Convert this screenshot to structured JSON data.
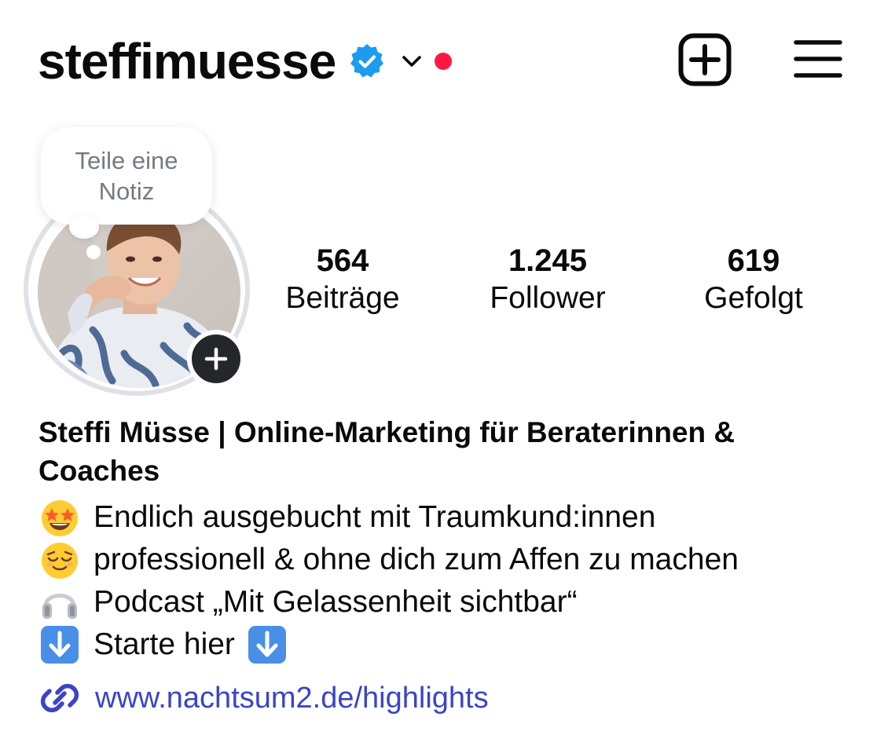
{
  "header": {
    "username": "steffimuesse",
    "verified_icon": "verified-badge-icon",
    "dropdown_icon": "chevron-down-icon",
    "notification_dot_color": "#ff1744",
    "new_post_icon": "plus-square-icon",
    "menu_icon": "hamburger-menu-icon"
  },
  "profile": {
    "note_text": "Teile eine Notiz",
    "add_story_icon": "plus-icon",
    "stats": [
      {
        "value": "564",
        "label": "Beiträge"
      },
      {
        "value": "1.245",
        "label": "Follower"
      },
      {
        "value": "619",
        "label": "Gefolgt"
      }
    ]
  },
  "bio": {
    "name": "Steffi Müsse | Online-Marketing für Beraterinnen & Coaches",
    "lines": [
      {
        "emoji": "star-struck-emoji",
        "text": "Endlich ausgebucht mit Traumkund:innen"
      },
      {
        "emoji": "relieved-face-emoji",
        "text": "professionell & ohne dich zum Affen zu machen"
      },
      {
        "emoji": "headphones-emoji",
        "text": "Podcast „Mit Gelassenheit sichtbar“"
      },
      {
        "emoji": "down-arrow-emoji",
        "text": "Starte hier"
      }
    ],
    "link_icon": "link-icon",
    "link": "www.nachtsum2.de/highlights",
    "link_color": "#3b44c8"
  }
}
